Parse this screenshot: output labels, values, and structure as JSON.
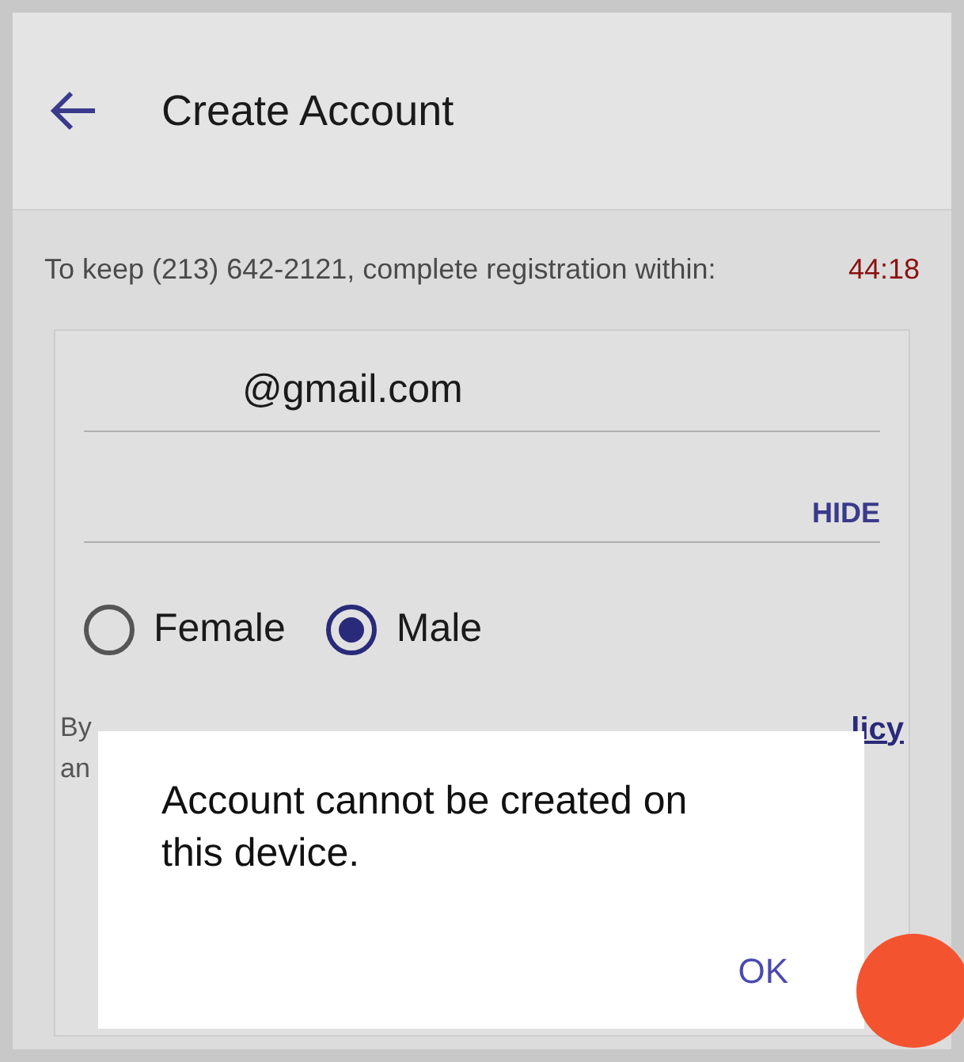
{
  "header": {
    "title": "Create Account"
  },
  "banner": {
    "text": "To keep (213) 642-2121, complete registration within:",
    "timer": "44:18"
  },
  "form": {
    "email": {
      "value": "@gmail.com"
    },
    "password": {
      "toggle": "HIDE"
    },
    "gender": [
      {
        "label": "Female",
        "selected": false
      },
      {
        "label": "Male",
        "selected": true
      }
    ],
    "terms": {
      "lines": [
        "By",
        "an"
      ],
      "link": "licy"
    }
  },
  "dialog": {
    "message": "Account cannot be created on this device.",
    "button": "OK"
  }
}
